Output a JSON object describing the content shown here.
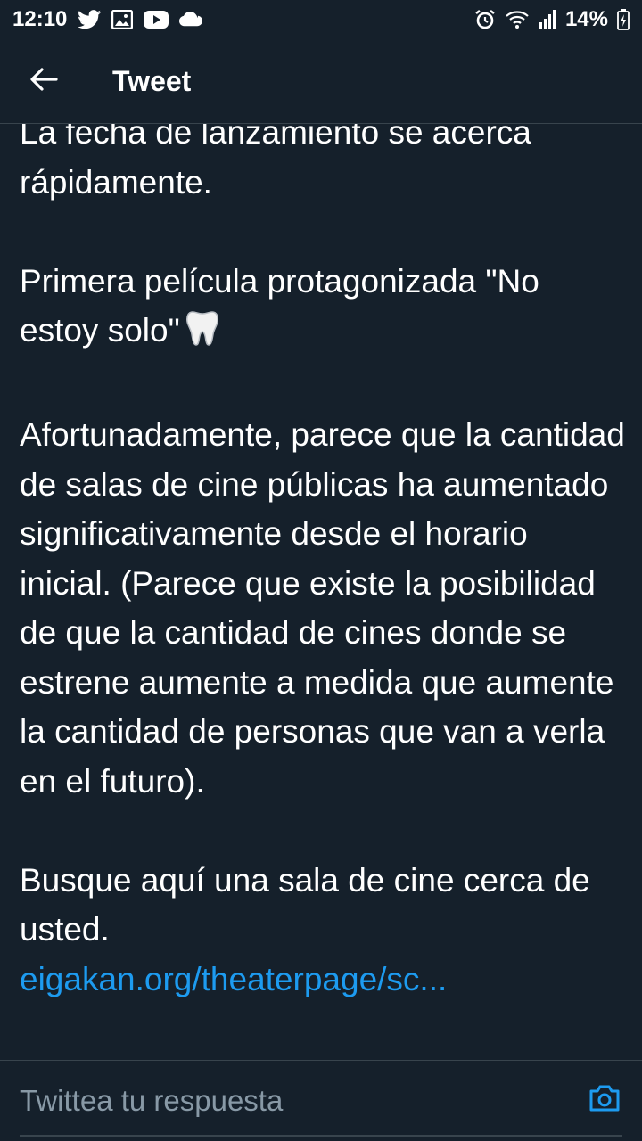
{
  "status_bar": {
    "time": "12:10",
    "battery": "14%",
    "icons": [
      "twitter-icon",
      "gallery-icon",
      "youtube-icon",
      "cloud-icon",
      "alarm-icon",
      "wifi-icon",
      "signal-icon",
      "battery-charging-icon"
    ]
  },
  "header": {
    "title": "Tweet",
    "back_icon": "arrow-left-icon"
  },
  "tweet": {
    "cut_off_line": "La fecha de lanzamiento se acerca",
    "p1_end": "rápidamente.",
    "p2": "Primera película protagonizada \"No estoy solo\"",
    "p2_emoji": "tooth-emoji",
    "p3": "Afortunadamente, parece que la cantidad de salas de cine públicas ha aumentado significativamente desde el horario inicial. (Parece que existe la posibilidad de que la cantidad de cines donde se estrene aumente a medida que aumente la cantidad de personas que van a verla en el futuro).",
    "p4": "Busque aquí una sala de cine cerca de usted.",
    "link": "eigakan.org/theaterpage/sc..."
  },
  "reply": {
    "placeholder": "Twittea tu respuesta",
    "camera_icon": "camera-icon"
  },
  "colors": {
    "background": "#15202b",
    "text": "#ffffff",
    "link": "#1d9bf0",
    "placeholder": "#8899a6",
    "divider": "#38444d"
  }
}
